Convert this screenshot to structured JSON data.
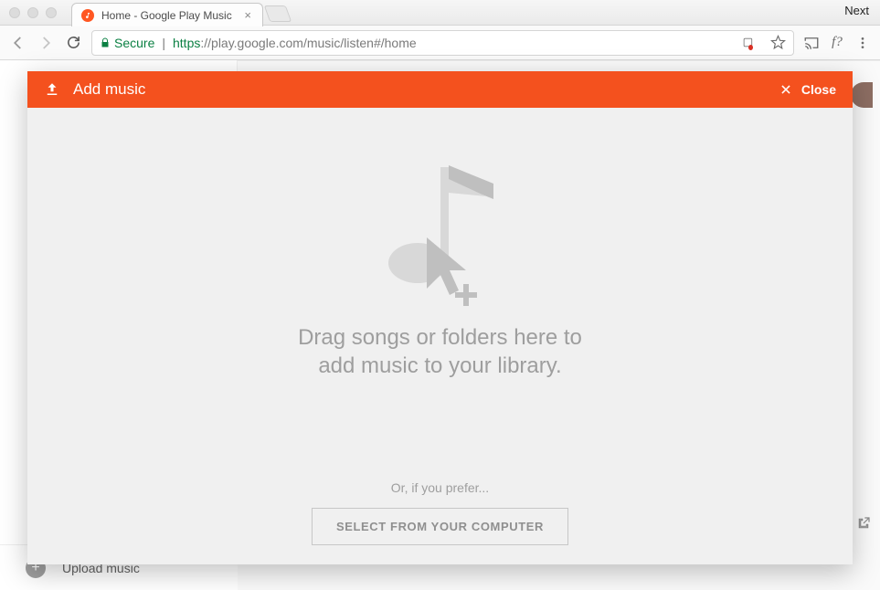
{
  "browser": {
    "tab_title": "Home - Google Play Music",
    "next_label": "Next",
    "secure_label": "Secure",
    "url_scheme": "https",
    "url_rest": "://play.google.com/music/listen#/home",
    "toolbar_f": "f?"
  },
  "page": {
    "upload_music_label": "Upload music"
  },
  "modal": {
    "title": "Add music",
    "close_label": "Close",
    "drop_line1": "Drag songs or folders here to",
    "drop_line2": "add music to your library.",
    "or_label": "Or, if you prefer...",
    "select_button_label": "SELECT FROM YOUR COMPUTER"
  }
}
